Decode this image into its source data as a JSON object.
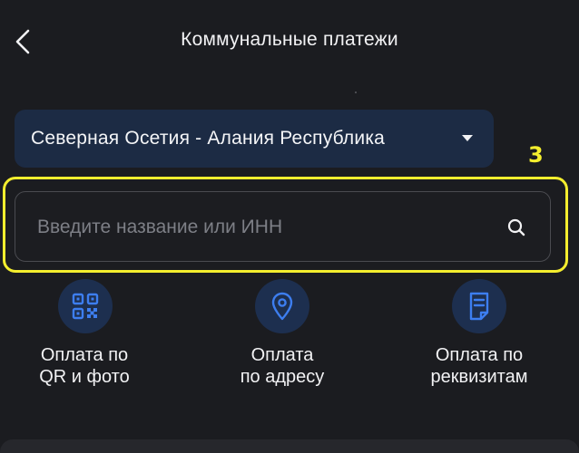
{
  "header": {
    "title": "Коммунальные платежи",
    "back_icon": "chevron-left-icon"
  },
  "region_select": {
    "selected": "Северная Осетия - Алания Республика",
    "caret_icon": "caret-down-icon"
  },
  "annotation": {
    "step_number": "3",
    "color": "#f4ee2e"
  },
  "search": {
    "value": "",
    "placeholder": "Введите название или ИНН",
    "icon": "search-icon"
  },
  "actions": [
    {
      "icon": "qr-code-icon",
      "line1": "Оплата по",
      "line2": "QR и фото"
    },
    {
      "icon": "location-pin-icon",
      "line1": "Оплата",
      "line2": "по адресу"
    },
    {
      "icon": "document-icon",
      "line1": "Оплата по",
      "line2": "реквизитам"
    }
  ],
  "colors": {
    "background": "#1b1c20",
    "region_select_bg": "#1c2b44",
    "icon_circle_bg": "#1d2f4f",
    "icon_accent": "#3d7ef0"
  }
}
